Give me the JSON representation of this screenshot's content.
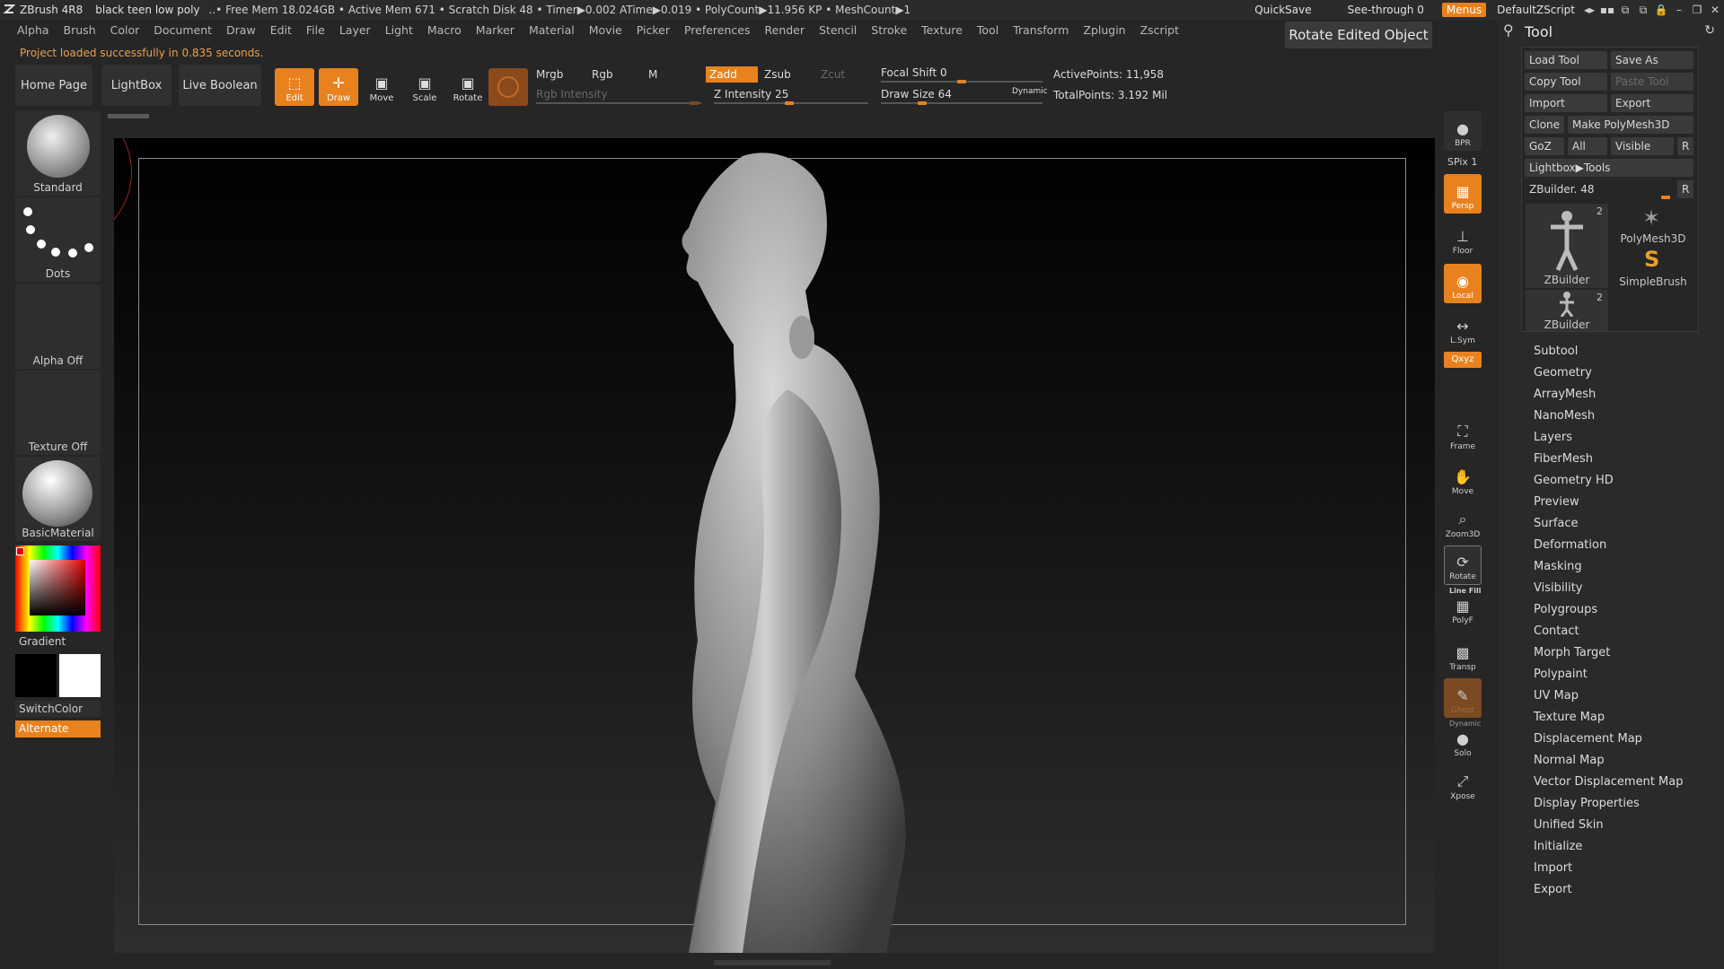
{
  "titlebar": {
    "app": "ZBrush 4R8",
    "project": "black teen low poly",
    "stats": "..• Free Mem 18.024GB • Active Mem 671 • Scratch Disk 48 • Timer▶0.002 ATime▶0.019 • PolyCount▶11.956 KP • MeshCount▶1",
    "quicksave": "QuickSave",
    "seethrough": "See-through  0",
    "menus": "Menus",
    "script": "DefaultZScript"
  },
  "menubar": [
    "Alpha",
    "Brush",
    "Color",
    "Document",
    "Draw",
    "Edit",
    "File",
    "Layer",
    "Light",
    "Macro",
    "Marker",
    "Material",
    "Movie",
    "Picker",
    "Preferences",
    "Render",
    "Stencil",
    "Stroke",
    "Texture",
    "Tool",
    "Transform",
    "Zplugin",
    "Zscript"
  ],
  "notice": "Project loaded successfully in 0.835 seconds.",
  "tooltip": "Rotate Edited Object",
  "toolbar": {
    "home": "Home Page",
    "lightbox": "LightBox",
    "liveboolean": "Live Boolean",
    "edit": "Edit",
    "draw": "Draw",
    "move": "Move",
    "scale": "Scale",
    "rotate": "Rotate",
    "mrgb": "Mrgb",
    "rgb": "Rgb",
    "m": "M",
    "rgb_intensity": "Rgb Intensity",
    "zadd": "Zadd",
    "zsub": "Zsub",
    "zcut": "Zcut",
    "z_intensity": "Z Intensity 25",
    "focal_shift": "Focal Shift 0",
    "draw_size": "Draw Size 64",
    "dynamic": "Dynamic",
    "active_points": "ActivePoints: 11,958",
    "total_points": "TotalPoints: 3.192 Mil"
  },
  "left": {
    "brush": "Standard",
    "stroke": "Dots",
    "alpha": "Alpha Off",
    "texture": "Texture Off",
    "material": "BasicMaterial",
    "gradient": "Gradient",
    "switchcolor": "SwitchColor",
    "alternate": "Alternate"
  },
  "rightbar": {
    "bpr": "BPR",
    "spix": "SPix 1",
    "persp": "Persp",
    "dynamic": "Dynamic",
    "floor": "Floor",
    "local": "Local",
    "lsym": "L.Sym",
    "xyz": "Qxyz",
    "frame": "Frame",
    "move": "Move",
    "zoom3d": "Zoom3D",
    "rotate": "Rotate",
    "linefill": "Line Fill",
    "polyf": "PolyF",
    "transp": "Transp",
    "ghost": "Ghost",
    "dynamic2": "Dynamic",
    "solo": "Solo",
    "xpose": "Xpose"
  },
  "toolpanel": {
    "title": "Tool",
    "load_tool": "Load Tool",
    "save_as": "Save As",
    "copy_tool": "Copy Tool",
    "paste_tool": "Paste Tool",
    "import": "Import",
    "export": "Export",
    "clone": "Clone",
    "make_polymesh": "Make PolyMesh3D",
    "goz": "GoZ",
    "all": "All",
    "visible": "Visible",
    "r": "R",
    "lightbox_tools": "Lightbox▶Tools",
    "zbuilder_slider": "ZBuilder. 48",
    "thumb1": "ZBuilder",
    "thumb1_count": "2",
    "thumb2": "PolyMesh3D",
    "thumb3": "SimpleBrush",
    "thumb4": "ZBuilder",
    "thumb4_count": "2",
    "sections": [
      "Subtool",
      "Geometry",
      "ArrayMesh",
      "NanoMesh",
      "Layers",
      "FiberMesh",
      "Geometry HD",
      "Preview",
      "Surface",
      "Deformation",
      "Masking",
      "Visibility",
      "Polygroups",
      "Contact",
      "Morph Target",
      "Polypaint",
      "UV Map",
      "Texture Map",
      "Displacement Map",
      "Normal Map",
      "Vector Displacement Map",
      "Display Properties",
      "Unified Skin",
      "Initialize",
      "Import",
      "Export"
    ]
  },
  "colors": {
    "accent": "#e8821e",
    "bg": "#262626",
    "panel": "#2a2a2a"
  }
}
